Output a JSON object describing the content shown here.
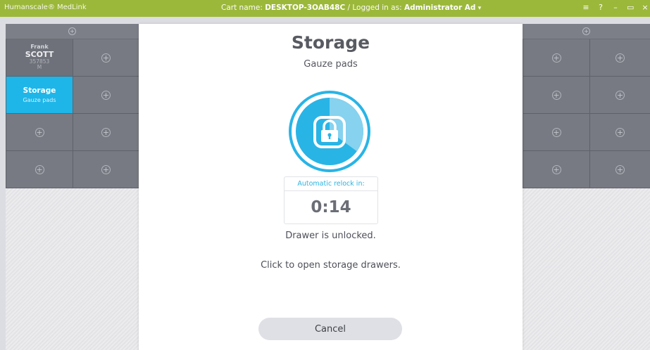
{
  "titlebar": {
    "app_name": "Humanscale® MedLink",
    "cart_prefix": "Cart name: ",
    "cart_name": "DESKTOP-3OAB48C",
    "logged_prefix": " / Logged in as: ",
    "user_name": "Administrator Ad",
    "user_dropdown_icon": "▾",
    "controls": {
      "menu_icon": "≡",
      "help_icon": "?",
      "minimize_icon": "–",
      "restore_icon": "▭",
      "close_icon": "×"
    },
    "color": "#9cb83b"
  },
  "left_panel": {
    "header_icon": "+",
    "patient": {
      "first_name": "Frank",
      "last_name": "SCOTT",
      "id": "357853",
      "gender": "M"
    },
    "active_cell": {
      "title": "Storage",
      "subtitle": "Gauze pads",
      "color": "#1eb6e8"
    },
    "plus_icon": "+"
  },
  "right_panel": {
    "header_icon": "+",
    "plus_icon": "+"
  },
  "modal": {
    "title": "Storage",
    "subtitle": "Gauze pads",
    "lock_icon": "lock-icon",
    "relock_label": "Automatic relock in:",
    "relock_time": "0:14",
    "relock_progress_fraction": 0.35,
    "status": "Drawer is unlocked.",
    "hint": "Click to open storage drawers.",
    "cancel_label": "Cancel",
    "accent_color": "#29b4e6"
  }
}
